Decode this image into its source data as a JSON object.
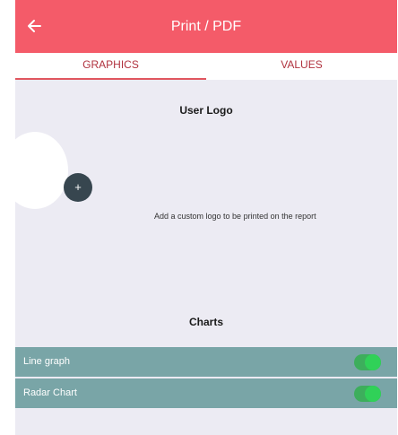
{
  "header": {
    "title": "Print / PDF",
    "back_icon": "arrow-left-icon"
  },
  "tabs": [
    {
      "label": "GRAPHICS",
      "active": true
    },
    {
      "label": "VALUES",
      "active": false
    }
  ],
  "user_logo": {
    "title": "User Logo",
    "add_button_label": "+",
    "hint": "Add a custom logo to be printed on the report"
  },
  "charts": {
    "title": "Charts",
    "items": [
      {
        "label": "Line graph",
        "enabled": true
      },
      {
        "label": "Radar Chart",
        "enabled": true
      }
    ]
  },
  "colors": {
    "header": "#F45B69",
    "tab_text": "#B0323E",
    "background": "#ECEBF3",
    "row": "#79A5A7",
    "toggle_on": "#30D158",
    "add_button": "#37464F"
  }
}
